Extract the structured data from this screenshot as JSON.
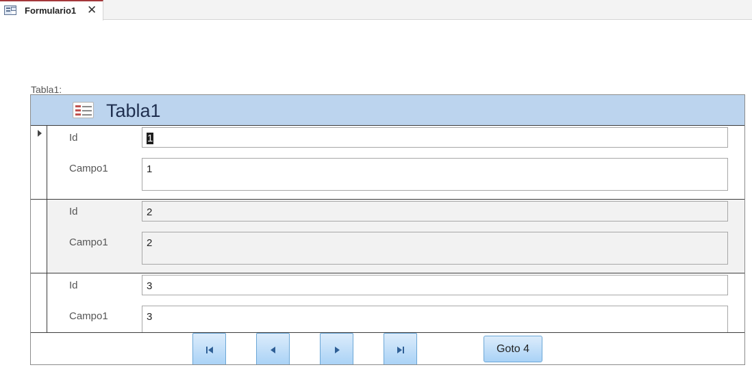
{
  "tab": {
    "label": "Formulario1",
    "close": "✕"
  },
  "caption": "Tabla1:",
  "subform": {
    "title": "Tabla1",
    "fields": {
      "id_label": "Id",
      "campo_label": "Campo1"
    },
    "records": [
      {
        "id": "1",
        "campo1": "1"
      },
      {
        "id": "2",
        "campo1": "2"
      },
      {
        "id": "3",
        "campo1": "3"
      }
    ]
  },
  "nav": {
    "icons": [
      "first-record-icon",
      "previous-record-icon",
      "next-record-icon",
      "last-record-icon"
    ],
    "goto_label": "Goto 4"
  },
  "colors": {
    "header_bg": "#bcd4ee",
    "button_accent": "#6aa6d6",
    "tab_accent": "#a4373a"
  }
}
